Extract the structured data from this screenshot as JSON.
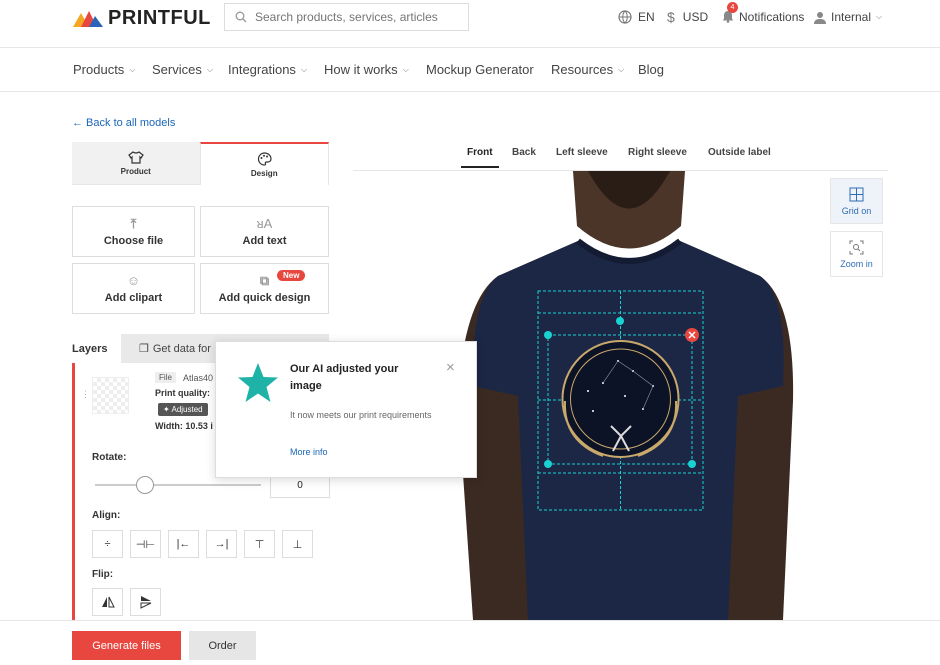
{
  "brand": {
    "name": "PRINTFUL"
  },
  "search": {
    "placeholder": "Search products, services, articles"
  },
  "topbar": {
    "language": "EN",
    "currency": "USD",
    "notifications_label": "Notifications",
    "notifications_count": "4",
    "account": "Internal"
  },
  "nav": {
    "items": [
      "Products",
      "Services",
      "Integrations",
      "How it works",
      "Mockup Generator",
      "Resources",
      "Blog"
    ]
  },
  "editor": {
    "back_link": "← Back to all models",
    "tabs": [
      {
        "label": "Product",
        "icon": "shirt-icon"
      },
      {
        "label": "Design",
        "icon": "palette-icon"
      }
    ],
    "tiles": [
      {
        "label": "Choose file",
        "icon": "upload-icon"
      },
      {
        "label": "Add text",
        "icon": "text-icon"
      },
      {
        "label": "Add clipart",
        "icon": "smiley-icon"
      },
      {
        "label": "Add quick design",
        "icon": "quick-design-icon",
        "badge": "New"
      }
    ],
    "layers_label": "Layers",
    "get_data_label": "Get data for",
    "layer": {
      "file_tag": "File",
      "file_name": "Atlas40",
      "print_quality_label": "Print quality:",
      "adjusted_badge": "✦ Adjusted",
      "width_text": "Width: 10.53 i"
    },
    "rotate_label": "Rotate:",
    "rotate_value": "0",
    "rotate_fraction": 0.3,
    "align_label": "Align:",
    "flip_label": "Flip:"
  },
  "popup": {
    "title": "Our AI adjusted your image",
    "body": "It now meets our print requirements",
    "link": "More info",
    "close": "×"
  },
  "views": {
    "tabs": [
      "Front",
      "Back",
      "Left sleeve",
      "Right sleeve",
      "Outside label"
    ],
    "active": "Front"
  },
  "side_tools": {
    "grid": "Grid on",
    "zoom": "Zoom in"
  },
  "bottom": {
    "generate": "Generate files",
    "order": "Order"
  },
  "colors": {
    "accent": "#e8473f",
    "link": "#1a66b8",
    "guide": "#19d3d3",
    "shirt": "#1c2746"
  }
}
